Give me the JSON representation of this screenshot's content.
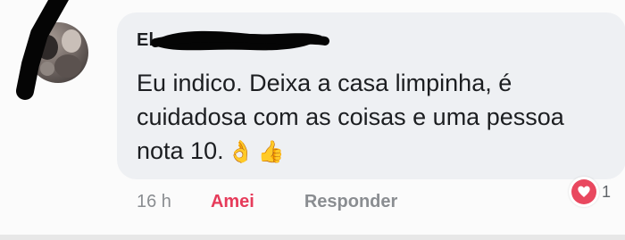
{
  "comment": {
    "author_visible": "El",
    "text": "Eu indico. Deixa a casa limpinha, é cuidadosa com as coisas e uma pessoa nota 10.",
    "emojis": [
      "👌",
      "👍"
    ]
  },
  "actions": {
    "time": "16 h",
    "love_label": "Amei",
    "reply_label": "Responder"
  },
  "reaction": {
    "icon": "heart-icon",
    "count": "1"
  },
  "colors": {
    "bubble": "#eef0f3",
    "love": "#e63b5a",
    "muted": "#8a8d91",
    "reaction": "#e9485f"
  }
}
